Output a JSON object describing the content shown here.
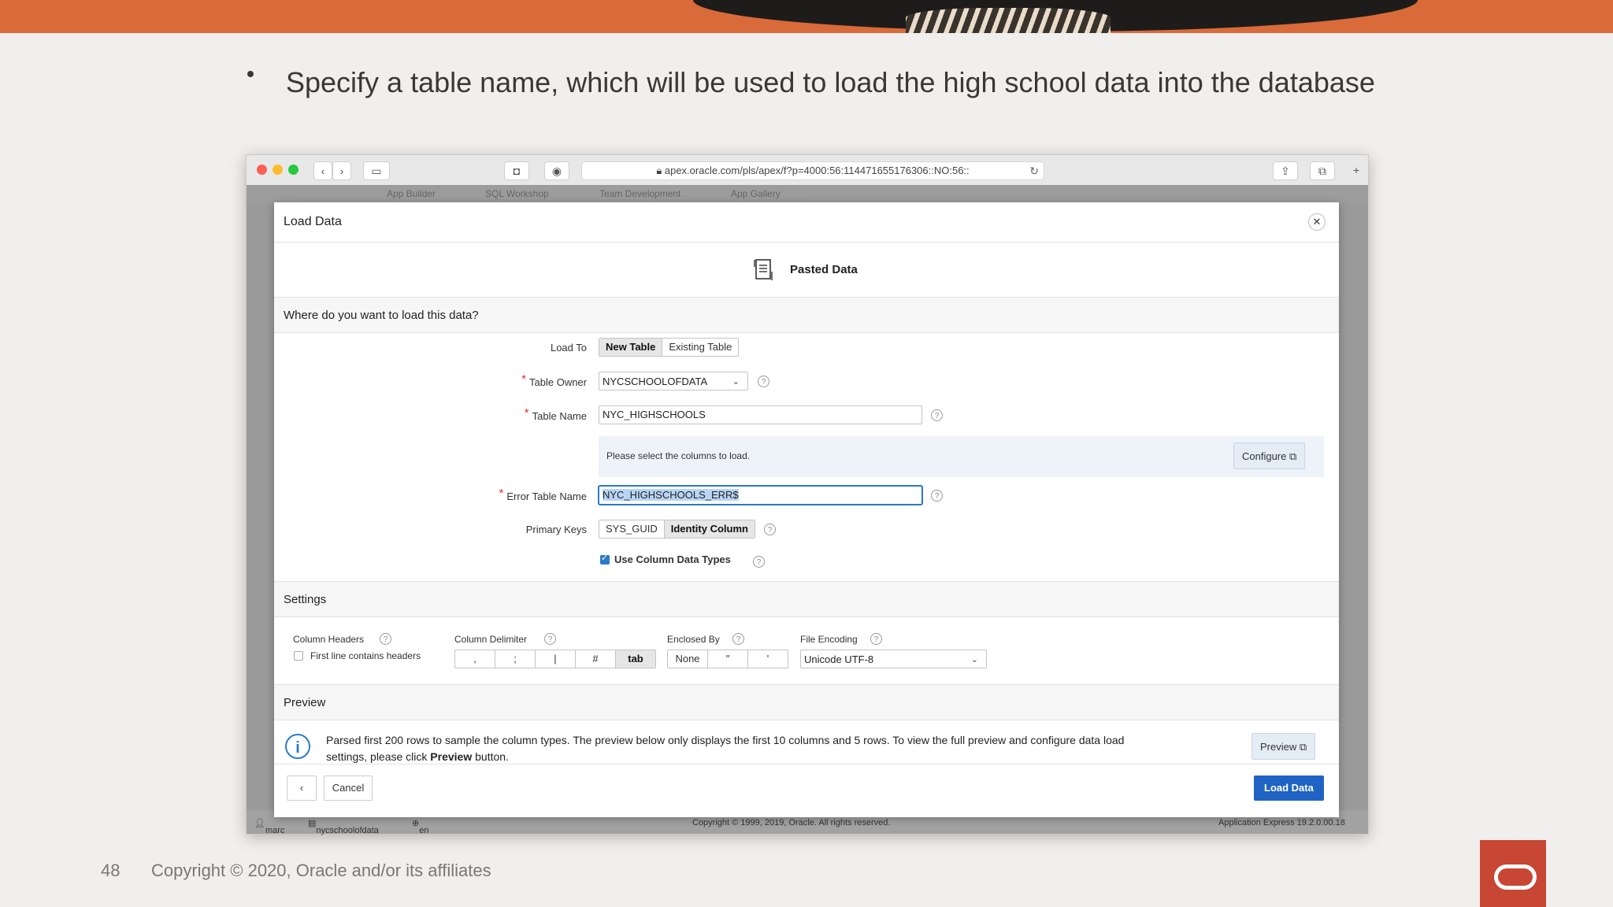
{
  "slide": {
    "bullet": "Specify a table name, which will be used to load the high school data into the database",
    "page_number": "48",
    "copyright": "Copyright © 2020, Oracle and/or its affiliates"
  },
  "browser": {
    "url": "apex.oracle.com/pls/apex/f?p=4000:56:114471655176306::NO:56::",
    "app_tabs": [
      "App Builder",
      "SQL Workshop",
      "Team Development",
      "App Gallery"
    ],
    "status": {
      "user": "marc",
      "workspace": "nycschoolofdata",
      "language": "en",
      "copyright": "Copyright © 1999, 2019, Oracle. All rights reserved.",
      "version": "Application Express 19.2.0.00.18"
    }
  },
  "dialog": {
    "title": "Load Data",
    "source": "Pasted Data",
    "where_heading": "Where do you want to load this data?",
    "load_to": {
      "label": "Load To",
      "options": [
        "New Table",
        "Existing Table"
      ],
      "selected": "New Table"
    },
    "table_owner": {
      "label": "Table Owner",
      "value": "NYCSCHOOLOFDATA"
    },
    "table_name": {
      "label": "Table Name",
      "value": "NYC_HIGHSCHOOLS"
    },
    "columns_note": "Please select the columns to load.",
    "configure_label": "Configure",
    "error_table": {
      "label": "Error Table Name",
      "value": "NYC_HIGHSCHOOLS_ERR$"
    },
    "primary_keys": {
      "label": "Primary Keys",
      "options": [
        "SYS_GUID",
        "Identity Column"
      ],
      "selected": "Identity Column"
    },
    "use_column_types": {
      "label": "Use Column Data Types",
      "checked": true
    },
    "settings": {
      "heading": "Settings",
      "column_headers_label": "Column Headers",
      "first_line_label": "First line contains headers",
      "first_line_checked": false,
      "delimiter_label": "Column Delimiter",
      "delimiters": [
        ",",
        ";",
        "|",
        "#",
        "tab"
      ],
      "delimiter_selected": "tab",
      "enclosed_label": "Enclosed By",
      "enclosed_options": [
        "None",
        "\"",
        "'"
      ],
      "encoding_label": "File Encoding",
      "encoding_value": "Unicode UTF-8"
    },
    "preview": {
      "heading": "Preview",
      "info_line1": "Parsed first 200 rows to sample the column types. The preview below only displays the first 10 columns and 5 rows. To view the full preview and configure data load",
      "info_line2_pre": "settings, please click ",
      "info_line2_bold": "Preview",
      "info_line2_post": " button.",
      "button_label": "Preview"
    },
    "cancel_label": "Cancel",
    "load_label": "Load Data"
  }
}
